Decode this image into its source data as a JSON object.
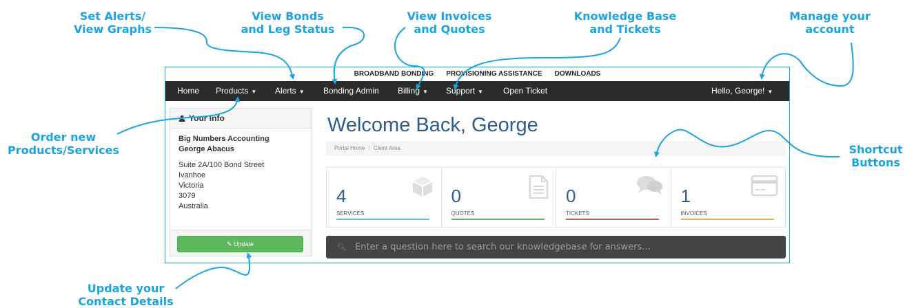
{
  "annotations": {
    "alerts": "Set Alerts/\nView Graphs",
    "bonds": "View Bonds\nand Leg Status",
    "invoices": "View Invoices\nand Quotes",
    "kb": "Knowledge Base\nand Tickets",
    "account": "Manage your\naccount",
    "products": "Order new\nProducts/Services",
    "shortcuts": "Shortcut\nButtons",
    "update": "Update your\nContact Details"
  },
  "top_menu": [
    "BROADBAND BONDING",
    "PROVISIONING ASSISTANCE",
    "DOWNLOADS"
  ],
  "nav": {
    "home": "Home",
    "products": "Products",
    "alerts": "Alerts",
    "bonding_admin": "Bonding Admin",
    "billing": "Billing",
    "support": "Support",
    "open_ticket": "Open Ticket",
    "user": "Hello, George!"
  },
  "info_panel": {
    "title": "Your Info",
    "company": "Big Numbers Accounting",
    "name": "George Abacus",
    "address": [
      "Suite 2A/100 Bond Street",
      "Ivanhoe",
      "Victoria",
      "3079",
      "Australia"
    ],
    "update_label": "Update"
  },
  "welcome": "Welcome Back, George",
  "breadcrumb": [
    "Portal Home",
    "Client Area"
  ],
  "tiles": [
    {
      "value": "4",
      "label": "SERVICES",
      "color": "#5bc0de",
      "icon": "cube-icon"
    },
    {
      "value": "0",
      "label": "QUOTES",
      "color": "#5cb85c",
      "icon": "document-icon"
    },
    {
      "value": "0",
      "label": "TICKETS",
      "color": "#d9534f",
      "icon": "comments-icon"
    },
    {
      "value": "1",
      "label": "INVOICES",
      "color": "#f0ad4e",
      "icon": "credit-card-icon"
    }
  ],
  "search_placeholder": "Enter a question here to search our knowledgebase for answers...",
  "colors": {
    "accent": "#1aa3e0",
    "nav_bg": "#2b2b2b",
    "heading": "#2d5d8b",
    "update_button": "#5cb85c"
  }
}
